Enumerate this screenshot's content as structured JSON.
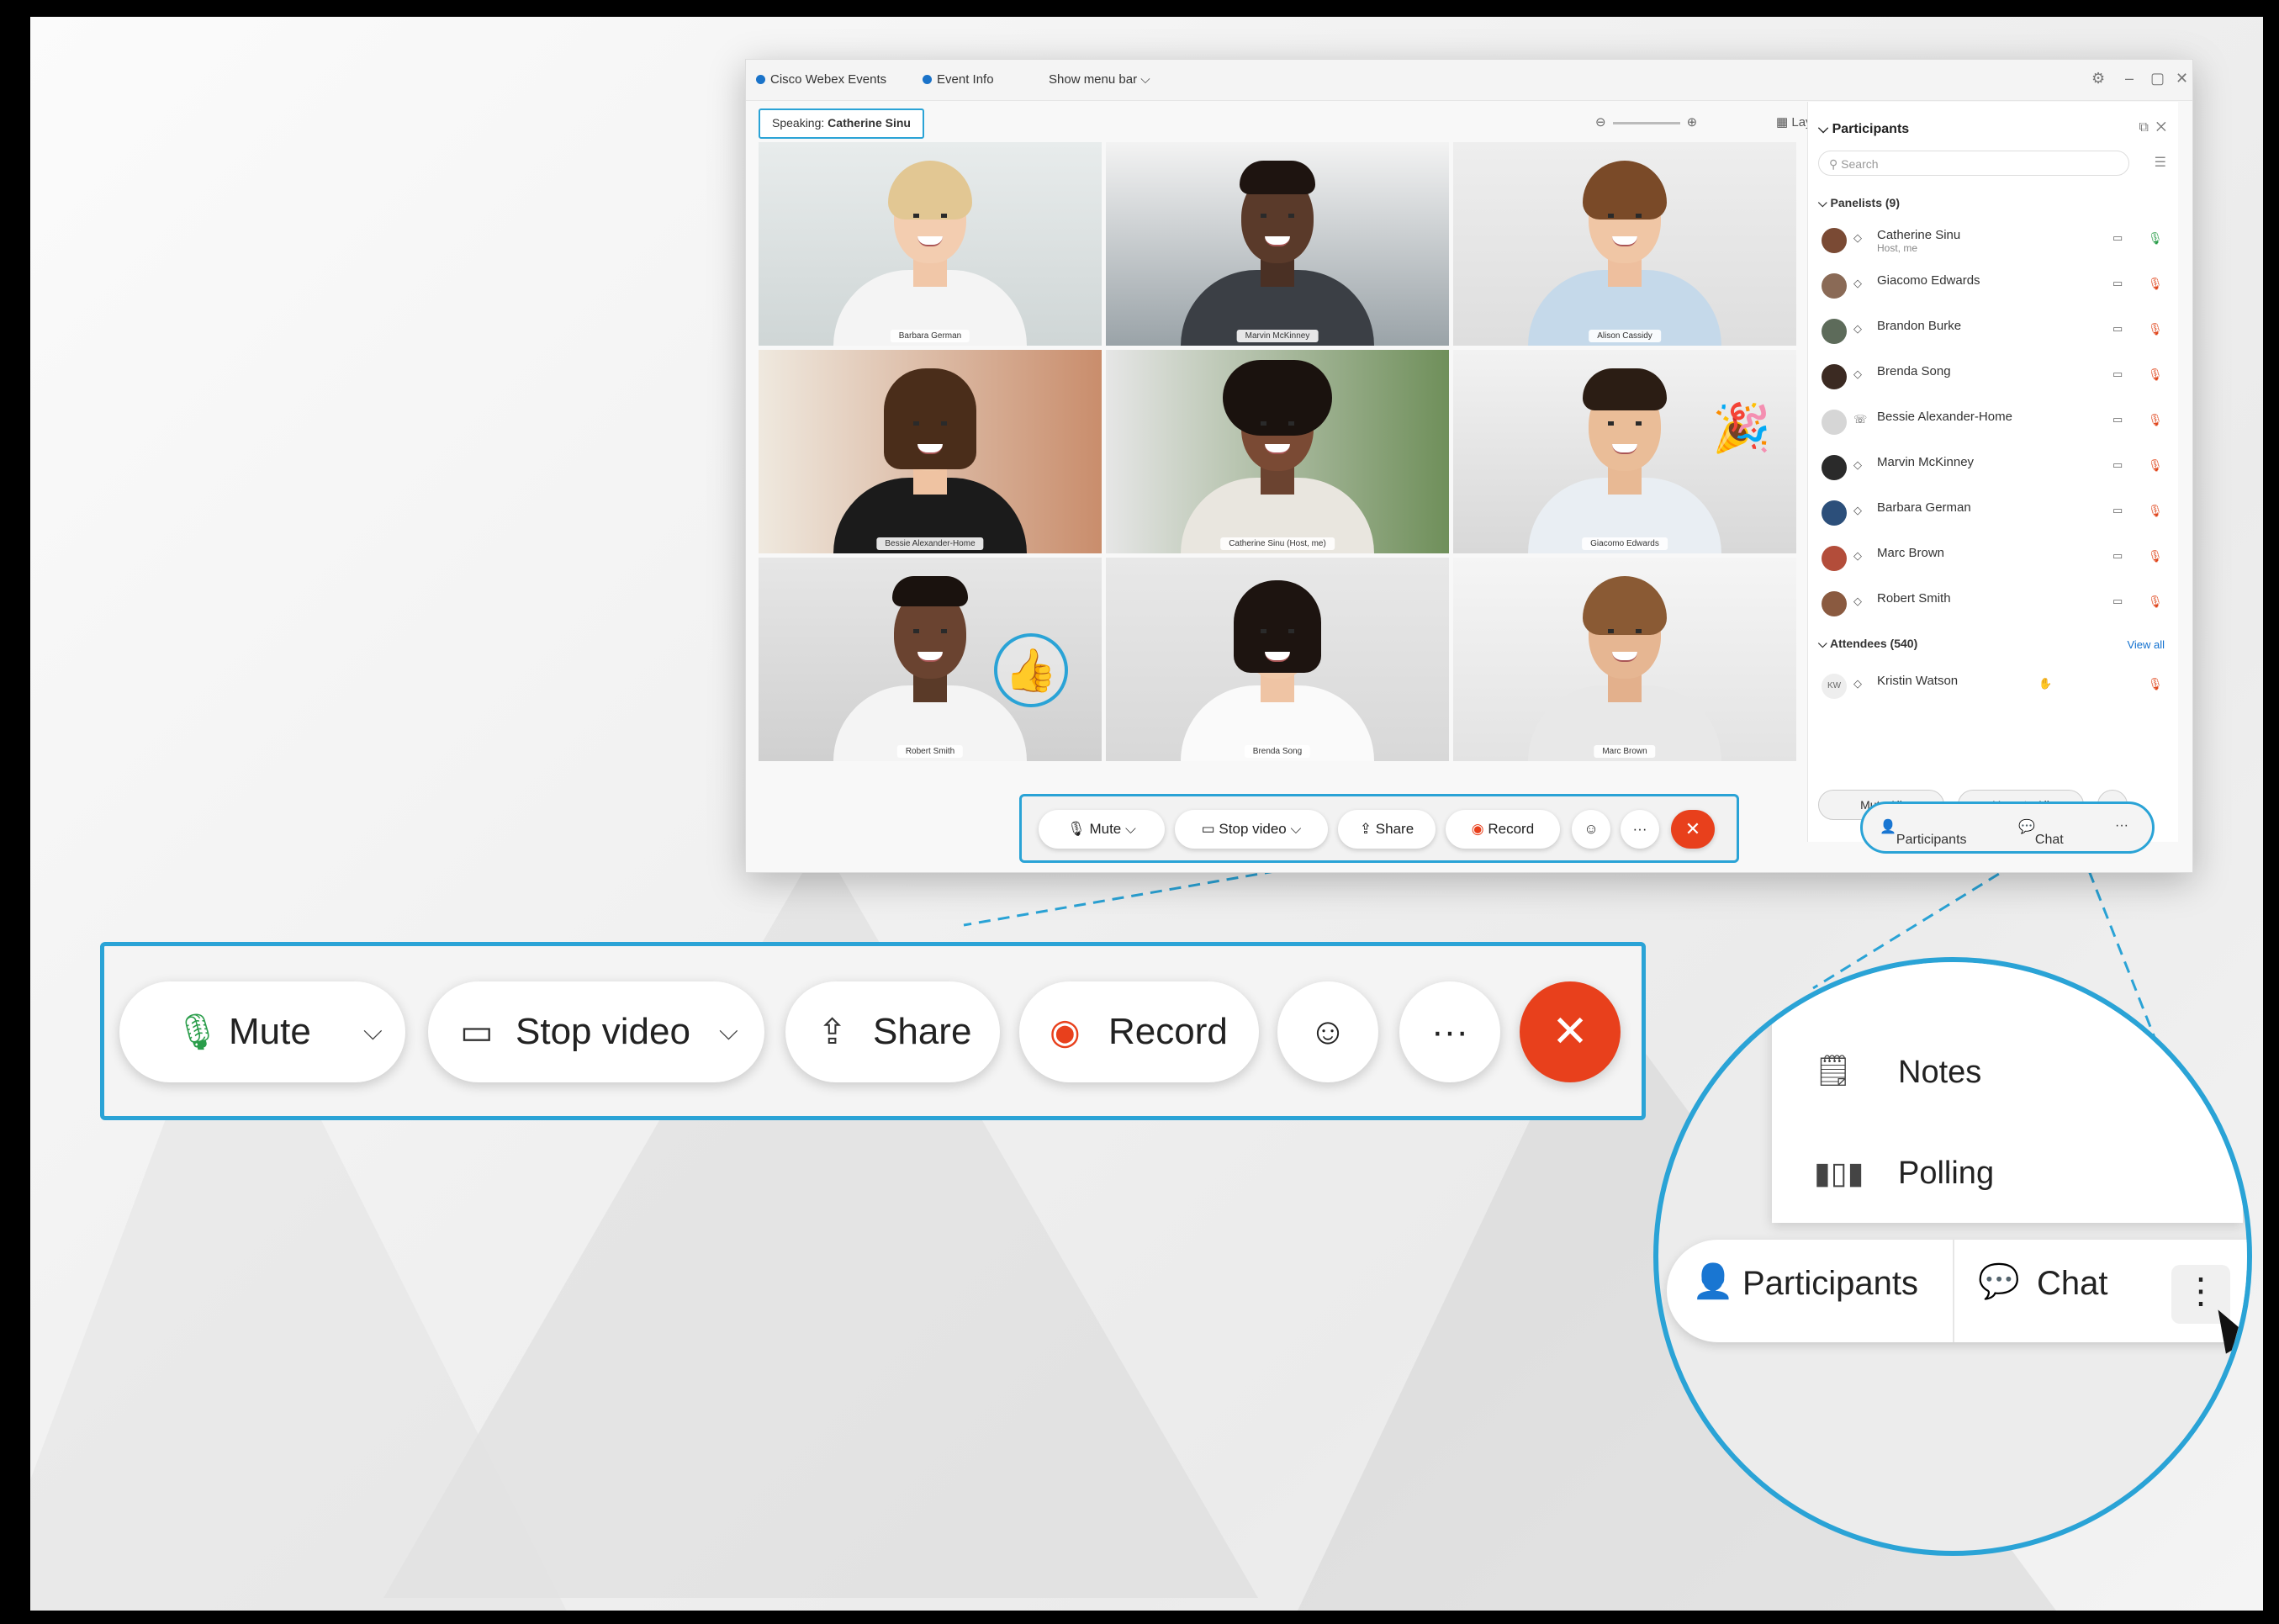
{
  "window": {
    "app_title": "Cisco Webex Events",
    "event_info": "Event Info",
    "show_menu_bar": "Show menu bar",
    "speaking_label": "Speaking:",
    "speaking_name": "Catherine Sinu",
    "layout_label": "Layout"
  },
  "video_tiles": [
    {
      "name": "Barbara German"
    },
    {
      "name": "Marvin McKinney"
    },
    {
      "name": "Alison Cassidy"
    },
    {
      "name": "Bessie Alexander-Home"
    },
    {
      "name": "Catherine Sinu (Host, me)"
    },
    {
      "name": "Giacomo Edwards"
    },
    {
      "name": "Robert Smith"
    },
    {
      "name": "Brenda Song"
    },
    {
      "name": "Marc Brown"
    }
  ],
  "participants_panel": {
    "title": "Participants",
    "search_placeholder": "Search",
    "panelists_label": "Panelists (9)",
    "panelists": [
      {
        "name": "Catherine Sinu",
        "sub": "Host, me"
      },
      {
        "name": "Giacomo Edwards",
        "sub": ""
      },
      {
        "name": "Brandon Burke",
        "sub": ""
      },
      {
        "name": "Brenda Song",
        "sub": ""
      },
      {
        "name": "Bessie Alexander-Home",
        "sub": ""
      },
      {
        "name": "Marvin McKinney",
        "sub": ""
      },
      {
        "name": "Barbara German",
        "sub": ""
      },
      {
        "name": "Marc Brown",
        "sub": ""
      },
      {
        "name": "Robert Smith",
        "sub": ""
      }
    ],
    "attendees_label": "Attendees (540)",
    "view_all": "View all",
    "attendee_name": "Kristin Watson",
    "attendee_initials": "KW",
    "mute_all": "Mute All",
    "unmute_all": "Unmute All"
  },
  "small_toolbar": {
    "mute": "Mute",
    "stop_video": "Stop video",
    "share": "Share",
    "record": "Record"
  },
  "small_right": {
    "participants": "Participants",
    "chat": "Chat"
  },
  "big_toolbar": {
    "mute": "Mute",
    "stop_video": "Stop video",
    "share": "Share",
    "record": "Record",
    "more": "···"
  },
  "magnifier": {
    "menu": [
      {
        "label": "Notes",
        "icon": "notes-icon"
      },
      {
        "label": "Polling",
        "icon": "polling-icon"
      }
    ],
    "participants": "Participants",
    "chat": "Chat"
  },
  "colors": {
    "accent": "#2aa3d6",
    "end_call": "#e8401c",
    "link": "#1170cf"
  }
}
